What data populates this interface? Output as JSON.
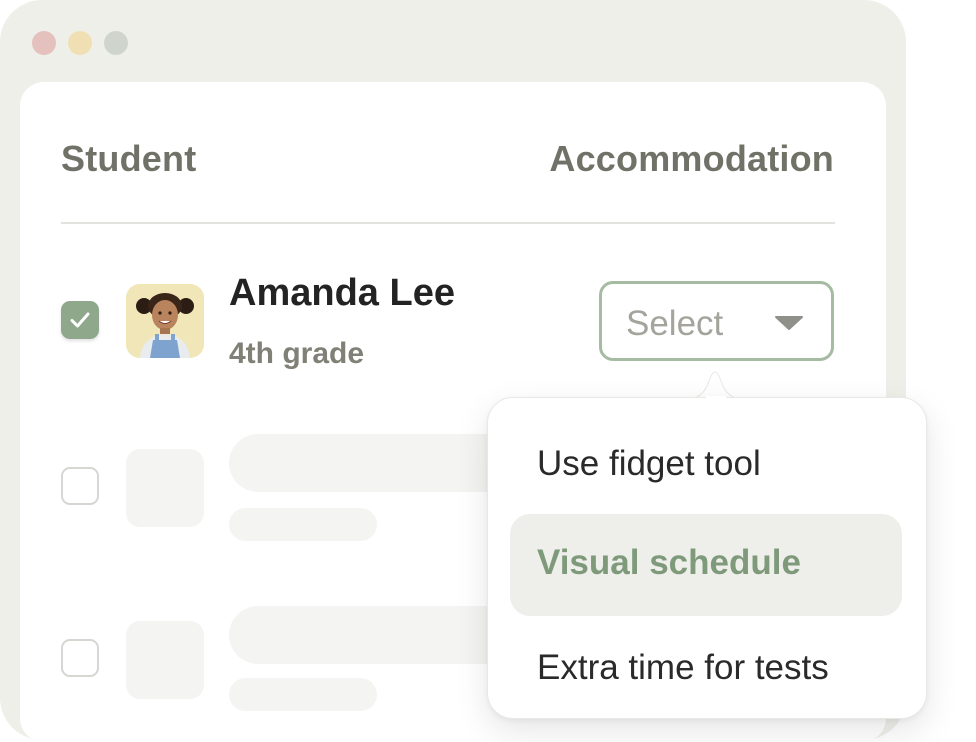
{
  "window": {
    "controls": [
      "close",
      "minimize",
      "zoom"
    ]
  },
  "table": {
    "headers": {
      "student": "Student",
      "accommodation": "Accommodation"
    }
  },
  "student_row": {
    "checked": true,
    "name": "Amanda Lee",
    "grade": "4th grade",
    "select": {
      "label": "Select"
    }
  },
  "dropdown": {
    "items": [
      {
        "label": "Use fidget tool",
        "highlighted": false
      },
      {
        "label": "Visual schedule",
        "highlighted": true
      },
      {
        "label": "Extra time for tests",
        "highlighted": false
      }
    ]
  },
  "colors": {
    "accent_green": "#8fa88c",
    "highlight_text": "#7e9a7b",
    "window_bg": "#efefea"
  },
  "icons": [
    "checkmark-icon",
    "caret-down-icon"
  ]
}
